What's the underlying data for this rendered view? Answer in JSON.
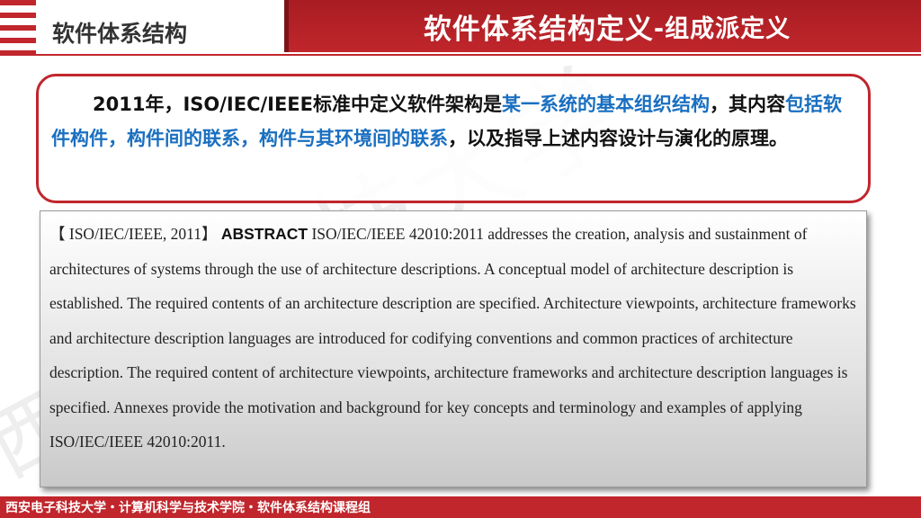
{
  "header": {
    "section_title": "软件体系结构",
    "title_main": "软件体系结构定义",
    "title_sub": "-组成派定义"
  },
  "definition": {
    "part1": "2011年，ISO/IEC/IEEE标准中定义软件架构是",
    "hl1": "某一系统的基本组织结构",
    "part2": "，其内容",
    "hl2": "包括软件构件，构件间的联系，构件与其环境间的联系",
    "part3": "，以及指导上述内容设计与演化的原理。"
  },
  "abstract": {
    "source": "【 ISO/IEC/IEEE, 2011】",
    "keyword": "ABSTRACT",
    "text": "ISO/IEC/IEEE 42010:2011 addresses the creation, analysis and sustainment of architectures of systems through the use of architecture descriptions. A conceptual model of architecture description is established. The required contents of an architecture description are specified. Architecture viewpoints, architecture frameworks and architecture description languages are introduced for codifying conventions and common practices of architecture description. The required content of architecture viewpoints, architecture frameworks and architecture description languages is specified. Annexes provide the motivation and background for key concepts and terminology and examples of applying ISO/IEC/IEEE 42010:2011."
  },
  "footer": {
    "text": "西安电子科技大学・计算机科学与技术学院・软件体系结构课程组"
  },
  "colors": {
    "accent": "#c0262c",
    "highlight": "#1a6fc0"
  }
}
